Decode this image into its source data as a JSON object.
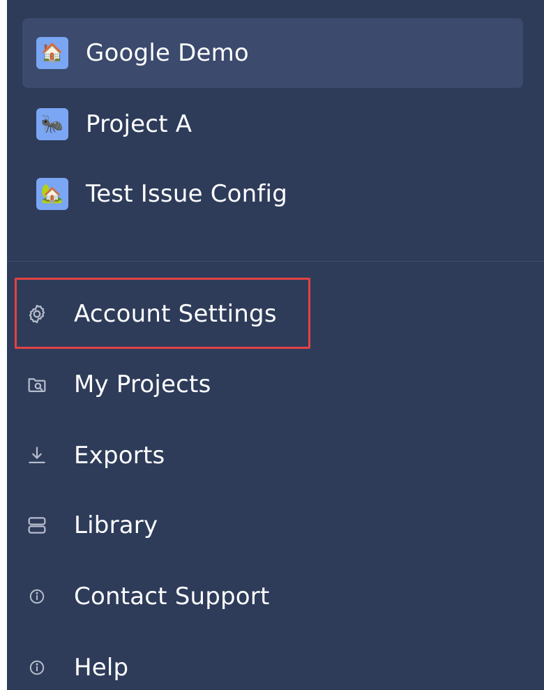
{
  "projects": [
    {
      "label": "Google Demo",
      "icon_glyph": "🏠",
      "icon": "house-icon",
      "active": true
    },
    {
      "label": "Project A",
      "icon_glyph": "🐜",
      "icon": "ant-icon",
      "active": false
    },
    {
      "label": "Test Issue Config",
      "icon_glyph": "🏡",
      "icon": "house-garden-icon",
      "active": false
    }
  ],
  "nav": [
    {
      "label": "Account Settings",
      "icon": "gear-icon"
    },
    {
      "label": "My Projects",
      "icon": "folder-search-icon"
    },
    {
      "label": "Exports",
      "icon": "download-icon"
    },
    {
      "label": "Library",
      "icon": "server-icon"
    },
    {
      "label": "Contact Support",
      "icon": "info-icon"
    },
    {
      "label": "Help",
      "icon": "info-icon"
    }
  ],
  "colors": {
    "sidebar_bg": "#2e3c5a",
    "active_item_bg": "#3b4a6d",
    "project_icon_bg": "#7aa6f3",
    "text": "#ffffff",
    "icon_muted": "#b5bccb",
    "highlight": "#e34244"
  }
}
